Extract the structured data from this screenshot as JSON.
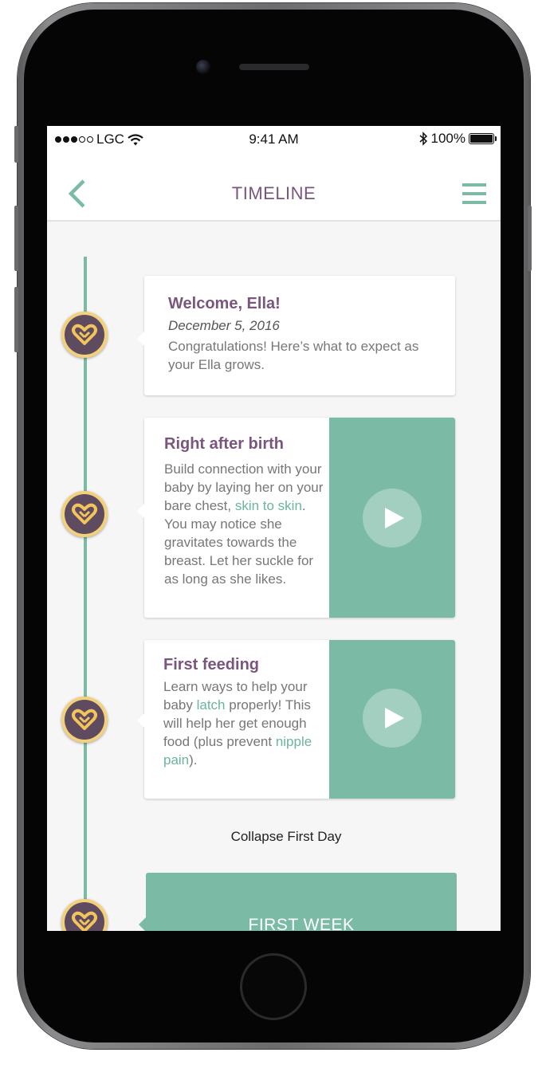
{
  "status_bar": {
    "carrier": "LGC",
    "time": "9:41 AM",
    "battery": "100%",
    "signal_filled": 3,
    "signal_total": 5
  },
  "nav": {
    "title": "TIMELINE",
    "back_icon": "chevron-left-icon",
    "menu_icon": "hamburger-menu-icon"
  },
  "colors": {
    "accent": "#7bbba6",
    "title": "#7a567e",
    "badge_ring": "#f3d07a",
    "badge_fill": "#5e4b5f"
  },
  "cards": [
    {
      "title": "Welcome, Ella!",
      "date": "December 5, 2016",
      "text": "Congratulations! Here’s what to expect as your Ella grows."
    },
    {
      "title": "Right after birth",
      "text_1": "Build connection with your baby by laying her on your bare chest, ",
      "link_1": "skin to skin",
      "text_2": ". You may notice she gravitates towards the breast. Let her suckle for as long as she likes."
    },
    {
      "title": "First feeding",
      "text_1": "Learn ways to help your baby ",
      "link_1": "latch",
      "text_2": " properly! This will help her get enough food (plus prevent ",
      "link_2": "nipple pain",
      "text_3": ")."
    }
  ],
  "collapse_label": "Collapse First Day",
  "week_label": "FIRST WEEK"
}
